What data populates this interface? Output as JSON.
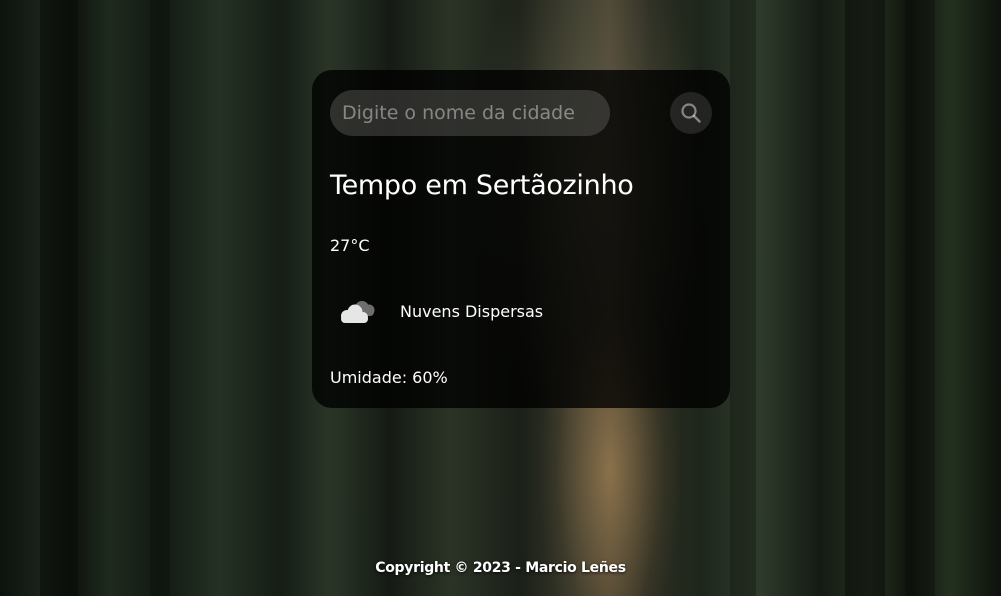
{
  "search": {
    "placeholder": "Digite o nome da cidade",
    "value": "",
    "button_icon": "search-icon"
  },
  "weather": {
    "title": "Tempo em Sertãozinho",
    "temperature": "27°C",
    "condition_icon": "cloud-icon",
    "condition": "Nuvens Dispersas",
    "humidity": "Umidade: 60%"
  },
  "footer": {
    "copyright": "Copyright © 2023 - Marcio Leñes"
  },
  "colors": {
    "card_background": "#000000",
    "text": "#ffffff"
  }
}
